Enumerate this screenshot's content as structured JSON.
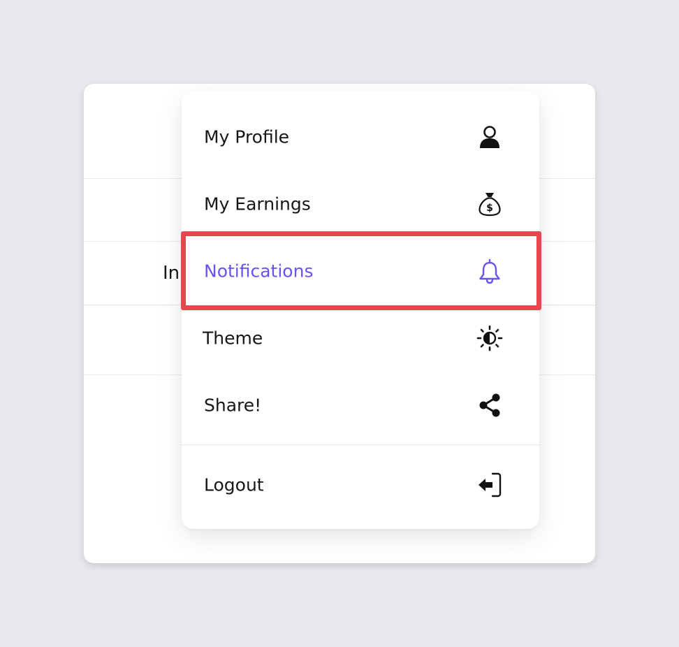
{
  "background": {
    "fragment_text": "In"
  },
  "menu": {
    "items": [
      {
        "label": "My Profile",
        "icon": "user-icon"
      },
      {
        "label": "My Earnings",
        "icon": "money-bag-icon"
      },
      {
        "label": "Notifications",
        "icon": "bell-icon",
        "active": true
      },
      {
        "label": "Theme",
        "icon": "theme-icon"
      },
      {
        "label": "Share!",
        "icon": "share-icon"
      },
      {
        "label": "Logout",
        "icon": "logout-icon"
      }
    ]
  },
  "colors": {
    "active": "#6654f0",
    "highlight": "#e8464f",
    "text": "#161616",
    "background": "#e6e8ec"
  }
}
